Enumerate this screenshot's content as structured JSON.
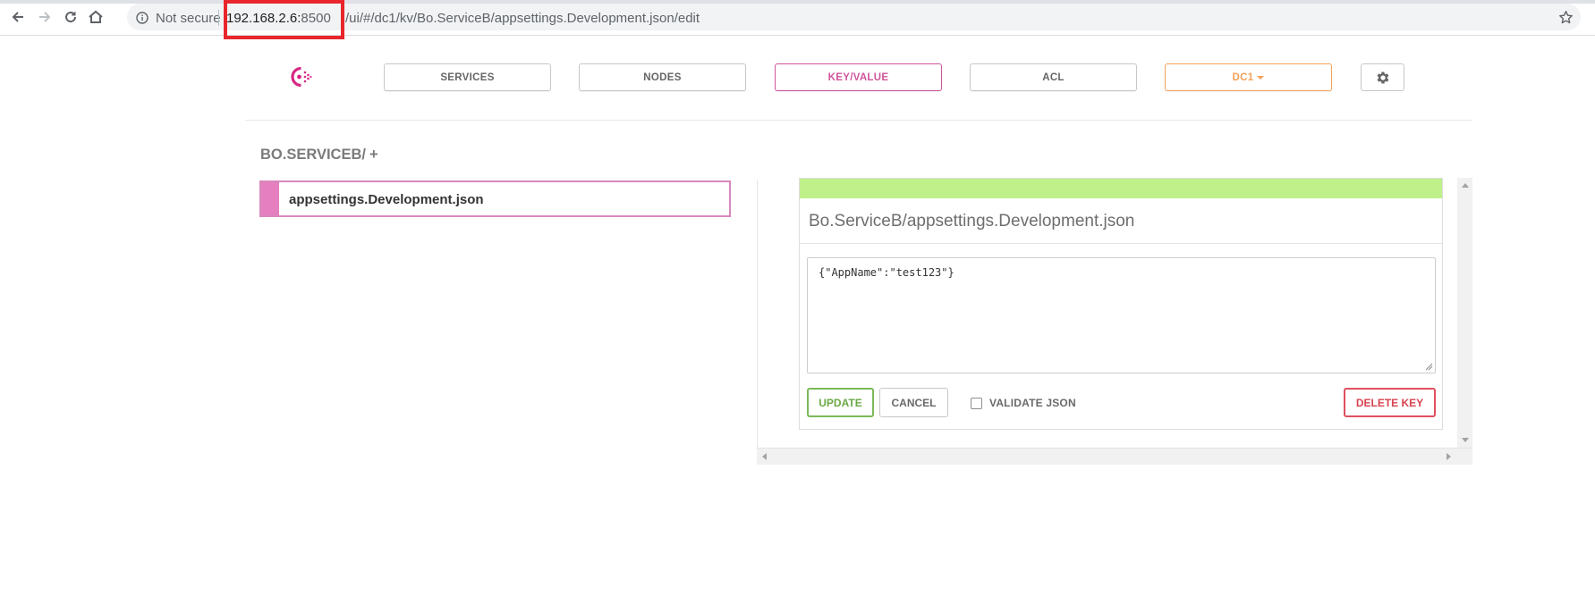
{
  "browser": {
    "not_secure": "Not secure",
    "url_host": "192.168.2.6:",
    "url_port": "8500",
    "url_path": "/ui/#/dc1/kv/Bo.ServiceB/appsettings.Development.json/edit",
    "highlight_color": "#e8262b"
  },
  "nav": {
    "tabs": [
      {
        "label": "SERVICES"
      },
      {
        "label": "NODES"
      },
      {
        "label": "KEY/VALUE",
        "active": true
      },
      {
        "label": "ACL"
      }
    ],
    "datacenter": "DC1",
    "settings_icon": "gear-icon",
    "accent_color": "#d0569c",
    "dc_color": "#f4a25b"
  },
  "kv": {
    "breadcrumb": "BO.SERVICEB/",
    "add_symbol": "+",
    "items": [
      {
        "label": "appsettings.Development.json",
        "selected": true
      }
    ]
  },
  "editor": {
    "title": "Bo.ServiceB/appsettings.Development.json",
    "value": "{\"AppName\":\"test123\"}",
    "update_label": "UPDATE",
    "cancel_label": "CANCEL",
    "validate_label": "VALIDATE JSON",
    "validate_checked": false,
    "delete_label": "DELETE KEY",
    "status_color": "#bff08a"
  }
}
